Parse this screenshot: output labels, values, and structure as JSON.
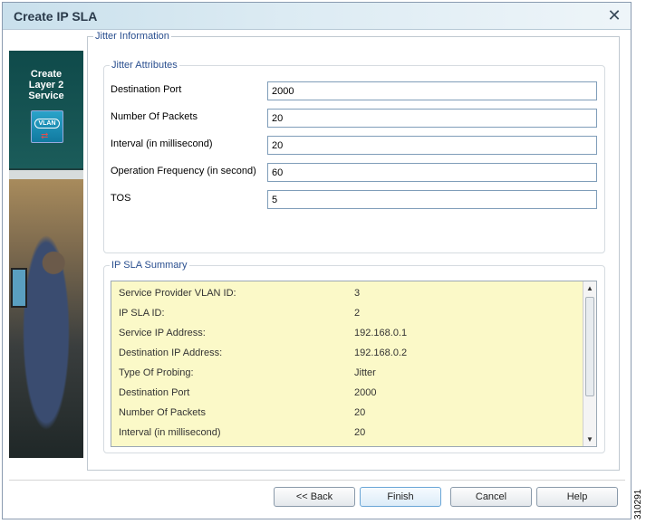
{
  "window": {
    "title": "Create IP SLA",
    "close_glyph": "✕"
  },
  "sidebar": {
    "title": "Create\nLayer 2\nService",
    "icon_label": "VLAN"
  },
  "panel": {
    "legend": "Jitter Information"
  },
  "jitter_attributes": {
    "legend": "Jitter Attributes",
    "fields": [
      {
        "label": "Destination Port",
        "value": "2000"
      },
      {
        "label": "Number Of Packets",
        "value": "20"
      },
      {
        "label": "Interval (in millisecond)",
        "value": "20"
      },
      {
        "label": "Operation Frequency (in second)",
        "value": "60"
      },
      {
        "label": "TOS",
        "value": "5"
      }
    ]
  },
  "summary": {
    "legend": "IP SLA Summary",
    "rows": [
      {
        "key": "Service Provider VLAN ID:",
        "value": "3"
      },
      {
        "key": "IP SLA ID:",
        "value": "2"
      },
      {
        "key": "Service IP Address:",
        "value": "192.168.0.1"
      },
      {
        "key": "Destination IP Address:",
        "value": "192.168.0.2"
      },
      {
        "key": "Type Of Probing:",
        "value": "Jitter"
      },
      {
        "key": "Destination Port",
        "value": "2000"
      },
      {
        "key": "Number Of Packets",
        "value": "20"
      },
      {
        "key": "Interval (in millisecond)",
        "value": "20"
      }
    ]
  },
  "buttons": {
    "back": "<< Back",
    "finish": "Finish",
    "cancel": "Cancel",
    "help": "Help"
  },
  "figure_id": "310291",
  "colors": {
    "legend_text": "#2a4f8f",
    "summary_bg": "#fbf9c8",
    "titlebar": "#c9e0ec"
  }
}
